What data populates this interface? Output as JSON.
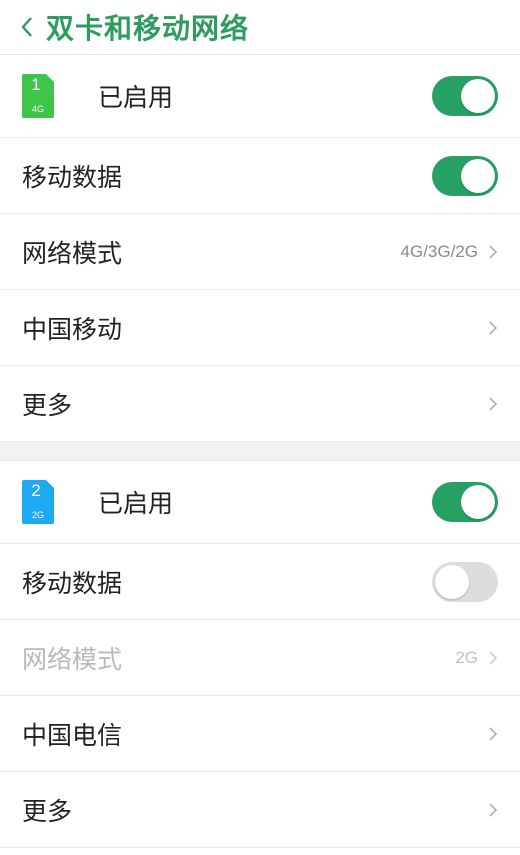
{
  "header": {
    "title": "双卡和移动网络",
    "back_icon": "back-chevron-icon"
  },
  "colors": {
    "accent": "#2e9b5f",
    "toggle_on": "#27a063",
    "sim1": "#3ec54a",
    "sim2": "#1eaaf1"
  },
  "sim1": {
    "number": "1",
    "network": "4G",
    "enabled_label": "已启用",
    "enabled": true,
    "rows": {
      "mobile_data": {
        "label": "移动数据",
        "on": true
      },
      "network_mode": {
        "label": "网络模式",
        "value": "4G/3G/2G"
      },
      "carrier": {
        "label": "中国移动"
      },
      "more": {
        "label": "更多"
      }
    }
  },
  "sim2": {
    "number": "2",
    "network": "2G",
    "enabled_label": "已启用",
    "enabled": true,
    "rows": {
      "mobile_data": {
        "label": "移动数据",
        "on": false
      },
      "network_mode": {
        "label": "网络模式",
        "value": "2G",
        "disabled": true
      },
      "carrier": {
        "label": "中国电信"
      },
      "more": {
        "label": "更多"
      }
    }
  }
}
